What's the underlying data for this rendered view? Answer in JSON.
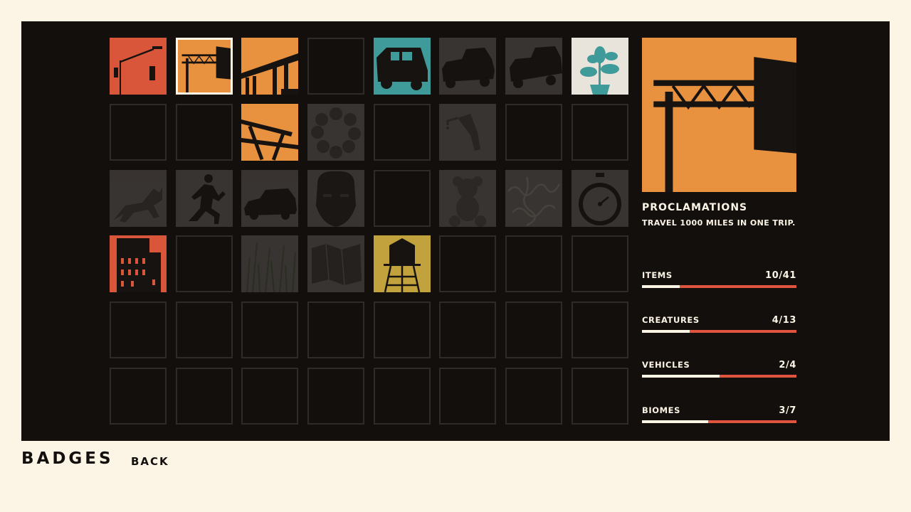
{
  "footer": {
    "title": "BADGES",
    "back_label": "BACK"
  },
  "detail": {
    "title": "PROCLAMATIONS",
    "description": "TRAVEL 1000 MILES IN ONE TRIP."
  },
  "stats": [
    {
      "label": "ITEMS",
      "count": "10/41",
      "fraction": 0.244
    },
    {
      "label": "CREATURES",
      "count": "4/13",
      "fraction": 0.308
    },
    {
      "label": "VEHICLES",
      "count": "2/4",
      "fraction": 0.5
    },
    {
      "label": "BIOMES",
      "count": "3/7",
      "fraction": 0.429
    }
  ],
  "colors": {
    "background": "#fcf5e6",
    "panel": "#130f0d",
    "orange": "#e8913f",
    "red": "#d9563b",
    "teal": "#3f9a9a",
    "mustard": "#c2a23c",
    "pale": "#e8e4db",
    "locked": "#3a3633",
    "bar_remaining": "#e0553f",
    "bar_fill": "#fcf5e6"
  },
  "badges": [
    [
      "streetlight-icon",
      "red",
      true,
      false
    ],
    [
      "highway-sign-icon",
      "orange",
      true,
      true
    ],
    [
      "overpass-icon",
      "orange",
      true,
      false
    ],
    [
      null,
      null,
      false,
      false
    ],
    [
      "van-icon",
      "teal",
      true,
      false
    ],
    [
      "pickup-truck-icon",
      "locked",
      false,
      false
    ],
    [
      "jeep-icon",
      "locked",
      false,
      false
    ],
    [
      "houseplant-icon",
      "pale",
      true,
      false
    ],
    [
      null,
      null,
      false,
      false
    ],
    [
      null,
      null,
      false,
      false
    ],
    [
      "picnic-table-icon",
      "orange",
      true,
      false
    ],
    [
      "wreath-icon",
      "locked",
      false,
      false
    ],
    [
      null,
      null,
      false,
      false
    ],
    [
      "fuel-nozzle-icon",
      "locked",
      false,
      false
    ],
    [
      null,
      null,
      false,
      false
    ],
    [
      null,
      null,
      false,
      false
    ],
    [
      "dog-icon",
      "locked",
      false,
      false
    ],
    [
      "runner-icon",
      "locked",
      false,
      false
    ],
    [
      "car-icon",
      "locked",
      false,
      false
    ],
    [
      "face-icon",
      "locked",
      false,
      false
    ],
    [
      null,
      null,
      false,
      false
    ],
    [
      "teddy-bear-icon",
      "locked",
      false,
      false
    ],
    [
      "squiggle-icon",
      "locked",
      false,
      false
    ],
    [
      "stopwatch-icon",
      "locked",
      false,
      false
    ],
    [
      "building-icon",
      "red",
      true,
      false
    ],
    [
      null,
      null,
      false,
      false
    ],
    [
      "tall-grass-icon",
      "locked",
      false,
      false
    ],
    [
      "map-icon",
      "locked",
      false,
      false
    ],
    [
      "water-tower-icon",
      "mustard",
      true,
      false
    ],
    [
      null,
      null,
      false,
      false
    ],
    [
      null,
      null,
      false,
      false
    ],
    [
      null,
      null,
      false,
      false
    ],
    [
      null,
      null,
      false,
      false
    ],
    [
      null,
      null,
      false,
      false
    ],
    [
      null,
      null,
      false,
      false
    ],
    [
      null,
      null,
      false,
      false
    ],
    [
      null,
      null,
      false,
      false
    ],
    [
      null,
      null,
      false,
      false
    ],
    [
      null,
      null,
      false,
      false
    ],
    [
      null,
      null,
      false,
      false
    ],
    [
      null,
      null,
      false,
      false
    ],
    [
      null,
      null,
      false,
      false
    ],
    [
      null,
      null,
      false,
      false
    ],
    [
      null,
      null,
      false,
      false
    ],
    [
      null,
      null,
      false,
      false
    ],
    [
      null,
      null,
      false,
      false
    ],
    [
      null,
      null,
      false,
      false
    ],
    [
      null,
      null,
      false,
      false
    ]
  ]
}
